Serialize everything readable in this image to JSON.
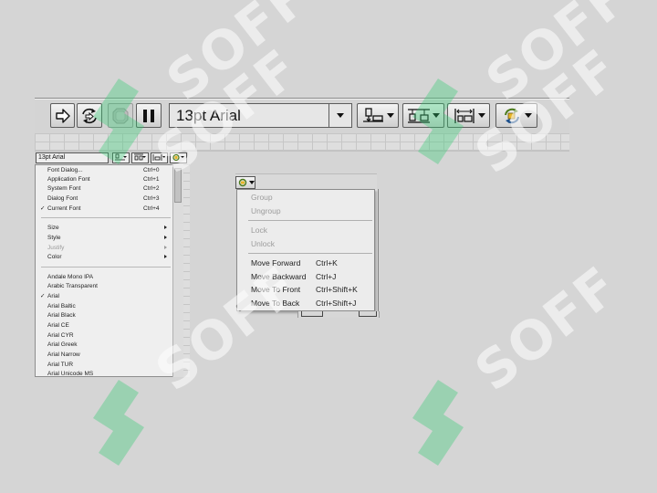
{
  "toolbar": {
    "font_value": "13pt Arial",
    "buttons": [
      "run-arrow",
      "run-continuously",
      "abort-execution",
      "pause",
      "align-objects",
      "distribute-objects",
      "resize-objects",
      "reorder"
    ]
  },
  "mini_toolbar": {
    "font_value": "13pt Arial"
  },
  "font_menu": {
    "items": [
      {
        "label": "Font Dialog...",
        "shortcut": "Ctrl+0"
      },
      {
        "label": "Application Font",
        "shortcut": "Ctrl+1"
      },
      {
        "label": "System Font",
        "shortcut": "Ctrl+2"
      },
      {
        "label": "Dialog Font",
        "shortcut": "Ctrl+3"
      },
      {
        "label": "Current Font",
        "shortcut": "Ctrl+4",
        "checked": true
      }
    ],
    "submenus": [
      {
        "label": "Size"
      },
      {
        "label": "Style"
      },
      {
        "label": "Justify",
        "disabled": true
      },
      {
        "label": "Color"
      }
    ],
    "fonts": [
      "Andale Mono IPA",
      "Arabic Transparent",
      "Arial",
      "Arial Baltic",
      "Arial Black",
      "Arial CE",
      "Arial CYR",
      "Arial Greek",
      "Arial Narrow",
      "Arial TUR",
      "Arial Unicode MS"
    ],
    "checked_font": "Arial",
    "check_mark": "✓"
  },
  "reorder_menu": {
    "group": [
      {
        "label": "Group",
        "disabled": true
      },
      {
        "label": "Ungroup",
        "disabled": true
      }
    ],
    "lock": [
      {
        "label": "Lock",
        "disabled": true
      },
      {
        "label": "Unlock",
        "disabled": true
      }
    ],
    "order": [
      {
        "label": "Move Forward",
        "shortcut": "Ctrl+K"
      },
      {
        "label": "Move Backward",
        "shortcut": "Ctrl+J"
      },
      {
        "label": "Move To Front",
        "shortcut": "Ctrl+Shift+K"
      },
      {
        "label": "Move To Back",
        "shortcut": "Ctrl+Shift+J"
      }
    ]
  },
  "watermark": {
    "text": "SOFF",
    "color": "#2ecc71"
  },
  "colors": {
    "background": "#d5d5d5",
    "toolbar": "#d4d4d4",
    "menu": "#efefef",
    "disabled_text": "#9c9c9c"
  }
}
